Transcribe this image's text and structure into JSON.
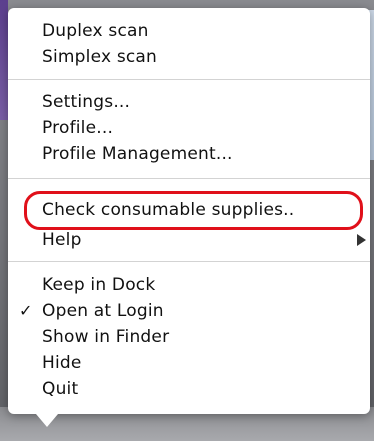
{
  "menu": {
    "groups": [
      {
        "items": [
          {
            "label": "Duplex scan",
            "checked": false,
            "has_submenu": false
          },
          {
            "label": "Simplex scan",
            "checked": false,
            "has_submenu": false
          }
        ]
      },
      {
        "items": [
          {
            "label": "Settings...",
            "checked": false,
            "has_submenu": false
          },
          {
            "label": "Profile...",
            "checked": false,
            "has_submenu": false
          },
          {
            "label": "Profile Management...",
            "checked": false,
            "has_submenu": false
          }
        ]
      },
      {
        "items": [
          {
            "label": "Check consumable supplies..",
            "checked": false,
            "has_submenu": false,
            "highlighted": true
          },
          {
            "label": "Help",
            "checked": false,
            "has_submenu": true
          }
        ]
      },
      {
        "items": [
          {
            "label": "Keep in Dock",
            "checked": false,
            "has_submenu": false
          },
          {
            "label": "Open at Login",
            "checked": true,
            "has_submenu": false
          },
          {
            "label": "Show in Finder",
            "checked": false,
            "has_submenu": false
          },
          {
            "label": "Hide",
            "checked": false,
            "has_submenu": false
          },
          {
            "label": "Quit",
            "checked": false,
            "has_submenu": false
          }
        ]
      }
    ],
    "check_glyph": "✓",
    "highlight_color": "#e0101a"
  }
}
